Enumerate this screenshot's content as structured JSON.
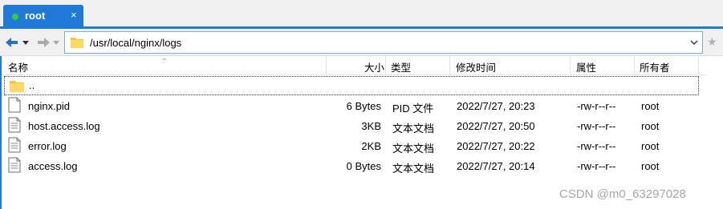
{
  "tab": {
    "title": "root",
    "close": "×"
  },
  "address": {
    "path": "/usr/local/nginx/logs"
  },
  "columns": {
    "name": "名称",
    "size": "大小",
    "type": "类型",
    "modified": "修改时间",
    "attributes": "属性",
    "owner": "所有者"
  },
  "parent_row": {
    "name": ".."
  },
  "files": [
    {
      "icon": "text-file-icon",
      "name": "nginx.pid",
      "size": "6 Bytes",
      "type": "PID 文件",
      "modified": "2022/7/27, 20:23",
      "attributes": "-rw-r--r--",
      "owner": "root"
    },
    {
      "icon": "text-file-icon",
      "name": "host.access.log",
      "size": "3KB",
      "type": "文本文档",
      "modified": "2022/7/27, 20:50",
      "attributes": "-rw-r--r--",
      "owner": "root"
    },
    {
      "icon": "text-file-icon",
      "name": "error.log",
      "size": "2KB",
      "type": "文本文档",
      "modified": "2022/7/27, 20:22",
      "attributes": "-rw-r--r--",
      "owner": "root"
    },
    {
      "icon": "text-file-icon",
      "name": "access.log",
      "size": "0 Bytes",
      "type": "文本文档",
      "modified": "2022/7/27, 20:14",
      "attributes": "-rw-r--r--",
      "owner": "root"
    }
  ],
  "watermark": "CSDN @m0_63297028",
  "colors": {
    "accent": "#1e7ad6",
    "status_dot": "#3cc83c"
  }
}
